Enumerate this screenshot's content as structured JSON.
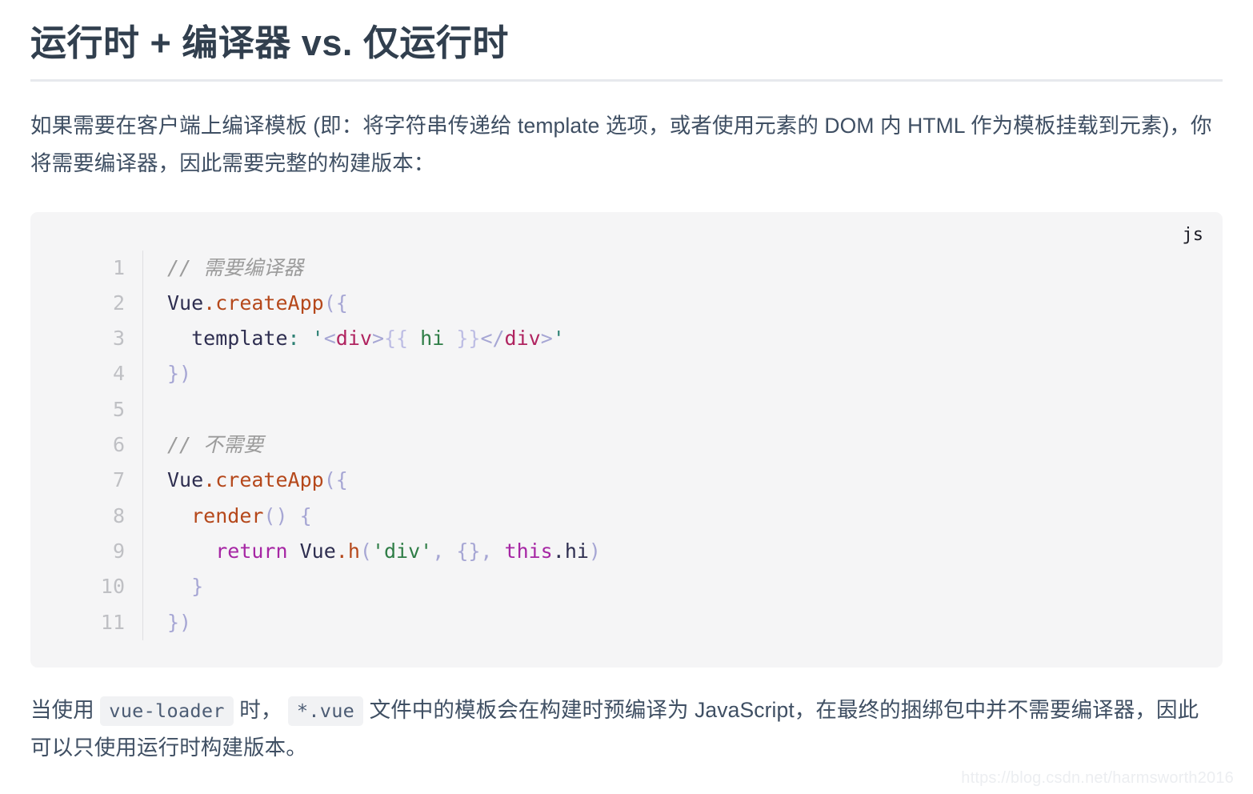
{
  "article": {
    "title": "运行时 + 编译器 vs. 仅运行时",
    "intro_paragraph": {
      "part1": "如果需要在客户端上编译模板 (即：将字符串传递给 template 选项，或者使用元素的 DOM 内 HTML 作为模板挂载到元素)，你将需要编译器，因此需要完整的构建版本："
    },
    "closing_paragraph": {
      "seg1": "当使用 ",
      "code1": "vue-loader",
      "seg2": " 时， ",
      "code2": "*.vue",
      "seg3": " 文件中的模板会在构建时预编译为 JavaScript，在最终的捆绑包中并不需要编译器，因此可以只使用运行时构建版本。"
    }
  },
  "code_block": {
    "language_label": "js",
    "line_numbers": [
      "1",
      "2",
      "3",
      "4",
      "5",
      "6",
      "7",
      "8",
      "9",
      "10",
      "11"
    ],
    "lines": [
      "// 需要编译器",
      "Vue.createApp({",
      "  template: '<div>{{ hi }}</div>'",
      "})",
      "",
      "// 不需要",
      "Vue.createApp({",
      "  render() {",
      "    return Vue.h('div', {}, this.hi)",
      "  }",
      "})"
    ],
    "tokens": {
      "l1_comment": "// 需要编译器",
      "l2_obj": "Vue",
      "l2_dot": ".",
      "l2_fn": "createApp",
      "l2_punct": "({",
      "l3_indent": "  ",
      "l3_key": "template",
      "l3_colon": ":",
      "l3_space": " ",
      "l3_quote_open": "'",
      "l3_lt": "<",
      "l3_tag": "div",
      "l3_gt": ">",
      "l3_mustache_open": "{{",
      "l3_interp": " hi ",
      "l3_mustache_close": "}}",
      "l3_lt_close": "</",
      "l3_tag_close": "div",
      "l3_gt_close": ">",
      "l3_quote_close": "'",
      "l4_punct": "})",
      "l5_blank": "",
      "l6_comment": "// 不需要",
      "l7_obj": "Vue",
      "l7_dot": ".",
      "l7_fn": "createApp",
      "l7_punct": "({",
      "l8_indent": "  ",
      "l8_fn": "render",
      "l8_parens": "()",
      "l8_space": " ",
      "l8_brace": "{",
      "l9_indent": "    ",
      "l9_keyword": "return",
      "l9_space": " ",
      "l9_obj": "Vue",
      "l9_dot": ".",
      "l9_fn": "h",
      "l9_paren_open": "(",
      "l9_string": "'div'",
      "l9_comma1": ", ",
      "l9_empty_obj": "{}",
      "l9_comma2": ", ",
      "l9_this": "this",
      "l9_dot2": ".",
      "l9_prop": "hi",
      "l9_paren_close": ")",
      "l10_indent": "  ",
      "l10_brace": "}",
      "l11_punct": "})"
    }
  },
  "watermark": {
    "text": "https://blog.csdn.net/harmsworth2016"
  },
  "colors": {
    "title": "#313f4e",
    "body_text": "#3f4f63",
    "code_bg": "#f5f5f6",
    "inline_code_bg": "#f1f2f4",
    "inline_code_text": "#4c5c74",
    "gutter_number": "#bfc0c4",
    "comment": "#9b9b9b",
    "function": "#b5481b",
    "string": "#2c8073",
    "keyword": "#a626a4",
    "tag": "#b02460",
    "punct": "#a6a6d4",
    "rule": "#e7e9ed"
  }
}
